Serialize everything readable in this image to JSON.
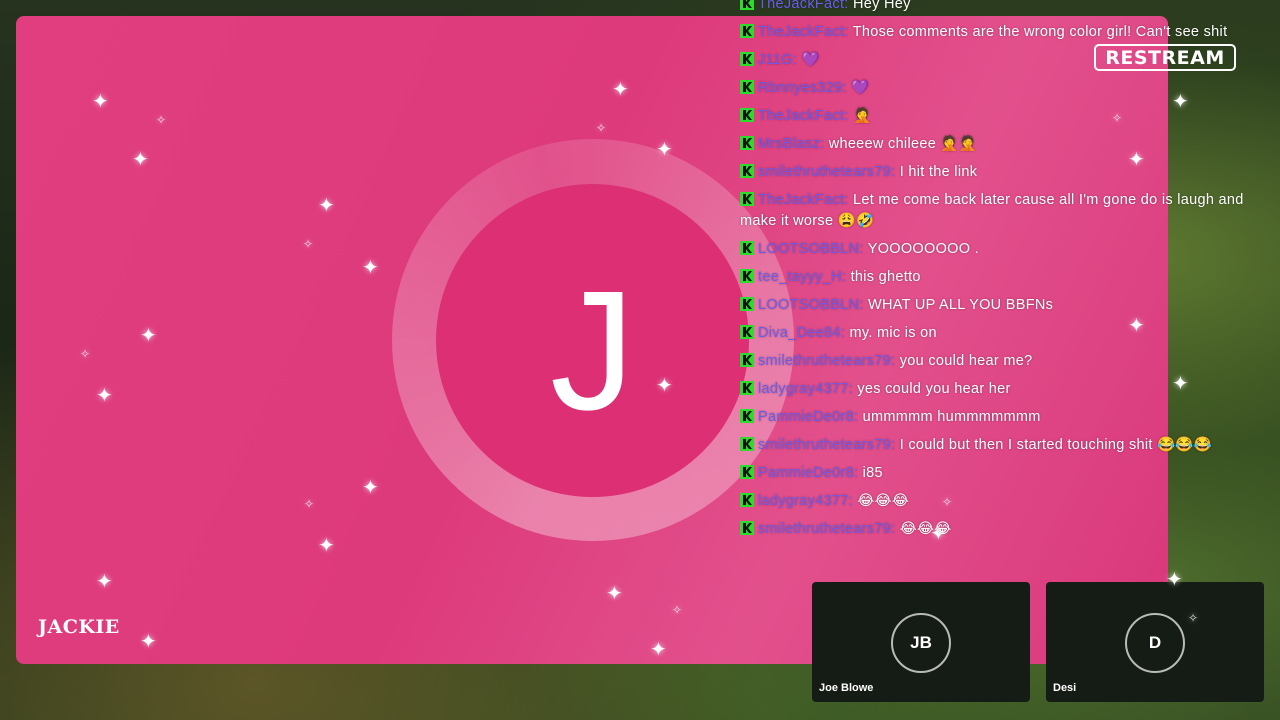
{
  "stage": {
    "avatar_letter": "J",
    "name_tag": "JACKIE",
    "brand": "RESTREAM"
  },
  "colors": {
    "stage_pink": "#e03e7f",
    "chat_username": "#6a5cf0",
    "chat_platform_icon": "#2bdc2b"
  },
  "chat": [
    {
      "user": "TheJackFact:",
      "text": "Hey Hey"
    },
    {
      "user": "TheJackFact:",
      "text": "Those comments are the wrong color girl! Can't see shit"
    },
    {
      "user": "J11G:",
      "text": "💜"
    },
    {
      "user": "Rbnnyes329:",
      "text": "💜"
    },
    {
      "user": "TheJackFact:",
      "text": "🤦"
    },
    {
      "user": "MrsBlasz:",
      "text": "wheeew chileee 🤦🤦"
    },
    {
      "user": "smilethruthetears79:",
      "text": "I hit the link"
    },
    {
      "user": "TheJackFact:",
      "text": "Let me come back later cause all I'm gone do is laugh and make it worse 😩🤣"
    },
    {
      "user": "LOOTSOBBLN:",
      "text": "YOOOOOOOO ."
    },
    {
      "user": "tee_tayyy_H:",
      "text": "this ghetto"
    },
    {
      "user": "LOOTSOBBLN:",
      "text": "WHAT UP ALL YOU BBFNs"
    },
    {
      "user": "Diva_Dee84:",
      "text": "my. mic is on"
    },
    {
      "user": "smilethruthetears79:",
      "text": "you could hear me?"
    },
    {
      "user": "ladygray4377:",
      "text": "yes could you hear her"
    },
    {
      "user": "PammieDe0r8:",
      "text": "ummmmm hummmmmmm"
    },
    {
      "user": "smilethruthetears79:",
      "text": "I could but then I started touching shit 😂😂😂"
    },
    {
      "user": "PammieDe0r8:",
      "text": "i85"
    },
    {
      "user": "ladygray4377:",
      "text": "😂😂😂"
    },
    {
      "user": "smilethruthetears79:",
      "text": "😂😂😂"
    }
  ],
  "guests": [
    {
      "initials": "JB",
      "name": "Joe Blowe"
    },
    {
      "initials": "D",
      "name": "Desi"
    }
  ]
}
